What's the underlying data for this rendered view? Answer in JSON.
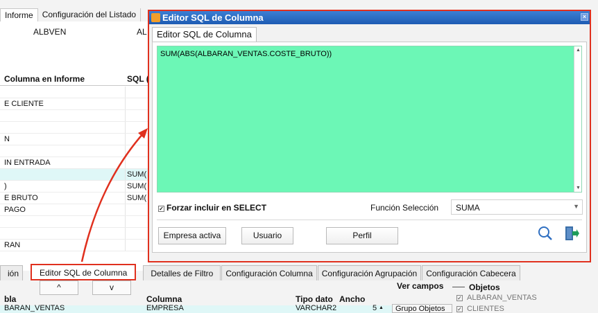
{
  "background": {
    "tabs": [
      "Informe",
      "Configuración del Listado"
    ],
    "field_value": "ALBVEN",
    "field_value_2": "AL",
    "grid_headers": [
      "Columna en Informe",
      "SQL ("
    ],
    "grid_rows": [
      {
        "c1": "",
        "c2": "",
        "hl": false
      },
      {
        "c1": "E CLIENTE",
        "c2": "",
        "hl": false
      },
      {
        "c1": "",
        "c2": "",
        "hl": false
      },
      {
        "c1": "",
        "c2": "",
        "hl": false
      },
      {
        "c1": "N",
        "c2": "",
        "hl": false
      },
      {
        "c1": "",
        "c2": "",
        "hl": false
      },
      {
        "c1": "IN ENTRADA",
        "c2": "",
        "hl": false
      },
      {
        "c1": "",
        "c2": "SUM(",
        "hl": true
      },
      {
        "c1": ")",
        "c2": "SUM(",
        "hl": false
      },
      {
        "c1": "E BRUTO",
        "c2": "SUM(",
        "hl": false
      },
      {
        "c1": "PAGO",
        "c2": "",
        "hl": false
      },
      {
        "c1": "",
        "c2": "",
        "hl": false
      },
      {
        "c1": "",
        "c2": "",
        "hl": false
      },
      {
        "c1": "RAN",
        "c2": "",
        "hl": false
      }
    ],
    "bottom_tabs": [
      "ión",
      "Editor SQL de Columna",
      "Detalles de Filtro",
      "Configuración Columna",
      "Configuración Agrupación",
      "Configuración Cabecera"
    ],
    "arrow_up": "^",
    "arrow_down": "v",
    "ver_campos": "Ver campos",
    "lower_headers": {
      "tabla": "bla",
      "columna": "Columna",
      "tipo": "Tipo dato",
      "ancho": "Ancho",
      "objetos": "Objetos"
    },
    "lower_row": {
      "tabla": "BARAN_VENTAS",
      "columna": "EMPRESA",
      "tipo": "VARCHAR2",
      "ancho": "5"
    },
    "group_button": "Grupo Objetos",
    "objects": [
      "ALBARAN_VENTAS",
      "CLIENTES"
    ]
  },
  "dialog": {
    "title": "Editor SQL de Columna",
    "tab_label": "Editor SQL de Columna",
    "sql_text": "SUM(ABS(ALBARAN_VENTAS.COSTE_BRUTO))",
    "force_select_label": "Forzar incluir en SELECT",
    "force_select_checked": true,
    "function_label": "Función Selección",
    "function_value": "SUMA",
    "buttons": {
      "empresa": "Empresa activa",
      "usuario": "Usuario",
      "perfil": "Perfil"
    },
    "icons": [
      "search-icon",
      "exit-icon"
    ]
  },
  "colors": {
    "editor_bg": "#6cf7b6",
    "highlight": "#e0301e",
    "titlebar": "#1e5cb3"
  }
}
